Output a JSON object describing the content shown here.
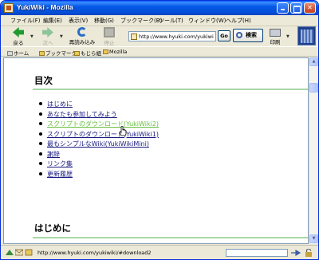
{
  "window": {
    "title": "YukiWiki - Mozilla"
  },
  "menu": {
    "items": [
      "ファイル(F)",
      "編集(E)",
      "表示(V)",
      "移動(G)",
      "ブックマーク(B)",
      "ツール(T)",
      "ウィンドウ(W)",
      "ヘルプ(H)"
    ]
  },
  "nav": {
    "back_label": "戻る",
    "forward_label": "次へ",
    "reload_label": "再読み込み",
    "stop_label": "停止",
    "url": "http://www.hyuki.com/yukiwi",
    "go_label": "Go",
    "search_label": "検索",
    "print_label": "印刷"
  },
  "bookmarks": {
    "items": [
      "ホーム",
      "ブックマーク",
      "もじら組",
      "Mozilla"
    ]
  },
  "content": {
    "toc_heading": "目次",
    "toc": [
      "はじめに",
      "あなたも参加してみよう",
      "スクリプトのダウンロード(YukiWiki2)",
      "スクリプトのダウンロード(YukiWiki1)",
      "最もシンプルなWiki(YukiWikiMini)",
      "謝辞",
      "リンク集",
      "更新履歴"
    ],
    "section_heading": "はじめに"
  },
  "status": {
    "text": "http://www.hyuki.com/yukiwiki/#download2",
    "progress": 0
  },
  "colors": {
    "titlebar": "#0458E6",
    "link": "#0000CC",
    "link_hover": "#6ABF40",
    "heading_rule": "#A8D8A8"
  },
  "icons": {
    "throbber": "mozilla-throbber-icon",
    "back": "back-arrow-icon",
    "forward": "forward-arrow-icon",
    "reload": "reload-icon",
    "stop": "stop-icon",
    "print": "print-icon",
    "search": "search-icon",
    "cursor": "hand-pointer-icon"
  }
}
